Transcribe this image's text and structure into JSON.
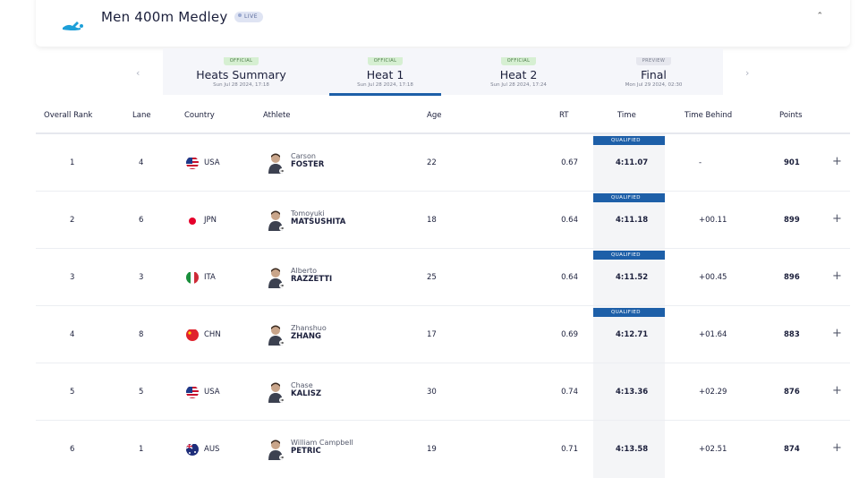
{
  "event": {
    "title": "Men 400m Medley",
    "live_label": "LIVE"
  },
  "tabs": [
    {
      "status": "OFFICIAL",
      "name": "Heats Summary",
      "date": "Sun Jul 28 2024, 17:18",
      "active": false
    },
    {
      "status": "OFFICIAL",
      "name": "Heat 1",
      "date": "Sun Jul 28 2024, 17:18",
      "active": true
    },
    {
      "status": "OFFICIAL",
      "name": "Heat 2",
      "date": "Sun Jul 28 2024, 17:24",
      "active": false
    },
    {
      "status": "PREVIEW",
      "name": "Final",
      "date": "Mon Jul 29 2024, 02:30",
      "active": false
    }
  ],
  "columns": {
    "rank": "Overall Rank",
    "lane": "Lane",
    "country": "Country",
    "athlete": "Athlete",
    "age": "Age",
    "rt": "RT",
    "time": "Time",
    "behind": "Time Behind",
    "points": "Points"
  },
  "qualified_label": "QUALIFIED",
  "rows": [
    {
      "rank": "1",
      "lane": "4",
      "country": "USA",
      "first": "Carson",
      "last": "FOSTER",
      "age": "22",
      "rt": "0.67",
      "time": "4:11.07",
      "behind": "-",
      "points": "901",
      "qualified": true
    },
    {
      "rank": "2",
      "lane": "6",
      "country": "JPN",
      "first": "Tomoyuki",
      "last": "MATSUSHITA",
      "age": "18",
      "rt": "0.64",
      "time": "4:11.18",
      "behind": "+00.11",
      "points": "899",
      "qualified": true
    },
    {
      "rank": "3",
      "lane": "3",
      "country": "ITA",
      "first": "Alberto",
      "last": "RAZZETTI",
      "age": "25",
      "rt": "0.64",
      "time": "4:11.52",
      "behind": "+00.45",
      "points": "896",
      "qualified": true
    },
    {
      "rank": "4",
      "lane": "8",
      "country": "CHN",
      "first": "Zhanshuo",
      "last": "ZHANG",
      "age": "17",
      "rt": "0.69",
      "time": "4:12.71",
      "behind": "+01.64",
      "points": "883",
      "qualified": true
    },
    {
      "rank": "5",
      "lane": "5",
      "country": "USA",
      "first": "Chase",
      "last": "KALISZ",
      "age": "30",
      "rt": "0.74",
      "time": "4:13.36",
      "behind": "+02.29",
      "points": "876",
      "qualified": false
    },
    {
      "rank": "6",
      "lane": "1",
      "country": "AUS",
      "first": "William Campbell",
      "last": "PETRIC",
      "age": "19",
      "rt": "0.71",
      "time": "4:13.58",
      "behind": "+02.51",
      "points": "874",
      "qualified": false
    }
  ],
  "icons": {
    "sport": "swimming-icon",
    "collapse": "chevron-up-icon",
    "prev": "chevron-left-icon",
    "next": "chevron-right-icon",
    "expand": "plus-icon"
  },
  "colors": {
    "accent": "#1d5fa8",
    "official_badge": "#d6efd2",
    "preview_badge": "#e6e7ee",
    "live_badge": "#dfe4f3"
  }
}
